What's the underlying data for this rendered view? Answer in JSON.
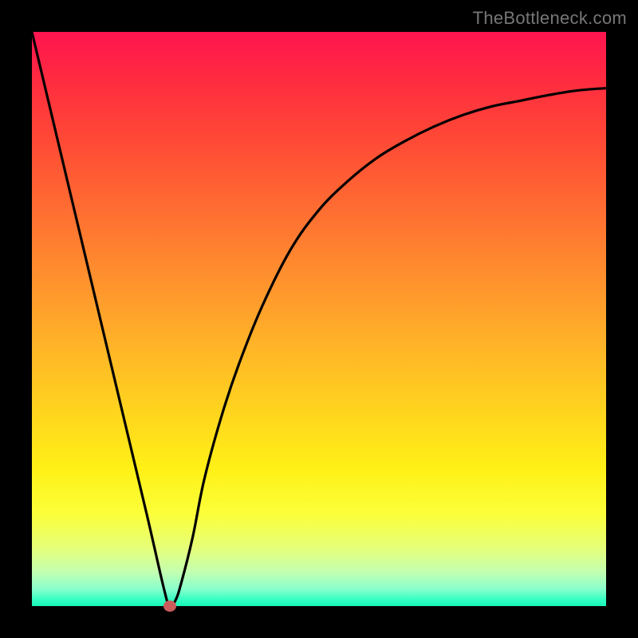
{
  "attribution": "TheBottleneck.com",
  "chart_data": {
    "type": "line",
    "title": "",
    "xlabel": "",
    "ylabel": "",
    "xlim": [
      0,
      100
    ],
    "ylim": [
      0,
      100
    ],
    "x": [
      0,
      5,
      10,
      15,
      20,
      23,
      24,
      25,
      26,
      28,
      30,
      33,
      36,
      40,
      45,
      50,
      55,
      60,
      65,
      70,
      75,
      80,
      85,
      90,
      95,
      100
    ],
    "values": [
      100,
      79,
      58,
      37,
      16,
      3,
      0,
      1,
      4,
      12,
      22,
      33,
      42,
      52,
      62,
      69,
      74,
      78,
      81,
      83.5,
      85.5,
      87,
      88,
      89,
      89.8,
      90.2
    ],
    "marker": {
      "x": 24,
      "y": 0
    },
    "gradient_stops": [
      {
        "pos": 0,
        "color": "#ff1450"
      },
      {
        "pos": 50,
        "color": "#ffb228"
      },
      {
        "pos": 85,
        "color": "#fbff3a"
      },
      {
        "pos": 100,
        "color": "#17f5b8"
      }
    ]
  }
}
